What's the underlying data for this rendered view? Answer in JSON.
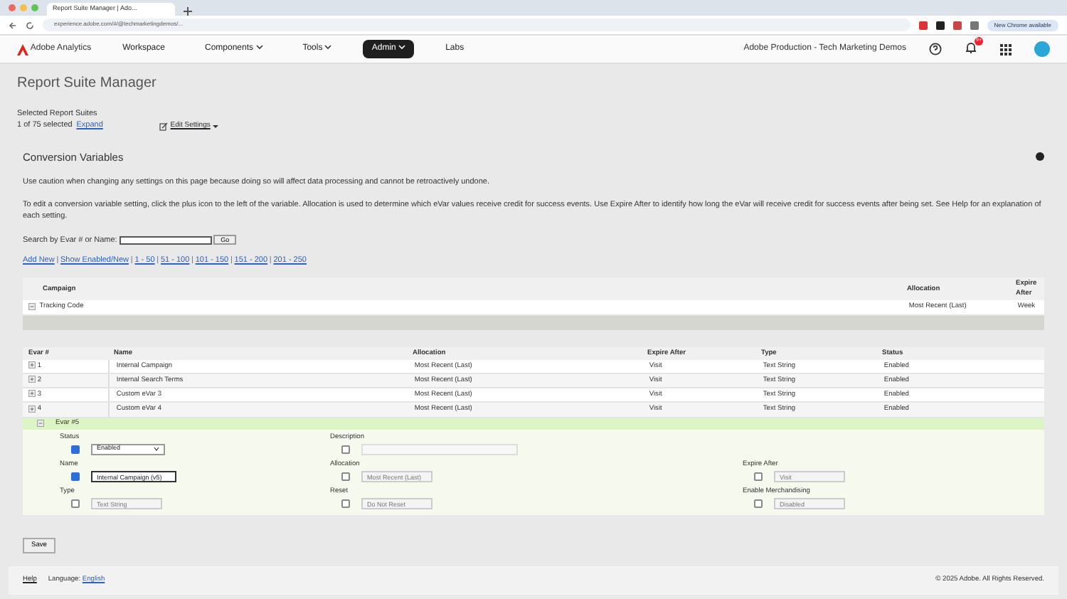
{
  "browser": {
    "tab_title": "Report Suite Manager | Ado...",
    "address": "experience.adobe.com/#/@techmarketingdemos/...",
    "update_button": "New Chrome available"
  },
  "nav": {
    "brand": "Adobe Analytics",
    "items": [
      {
        "label": "Workspace",
        "dropdown": false,
        "selected": false
      },
      {
        "label": "Components",
        "dropdown": true,
        "selected": false
      },
      {
        "label": "Tools",
        "dropdown": true,
        "selected": false
      },
      {
        "label": "Admin",
        "dropdown": true,
        "selected": true
      },
      {
        "label": "Labs",
        "dropdown": false,
        "selected": false
      }
    ],
    "org": "Adobe Production - Tech Marketing Demos",
    "notifications": "9+"
  },
  "page_title": "Report Suite Manager",
  "selection": {
    "label": "Selected Report Suites",
    "count": "1 of 75 selected",
    "expand": "Expand",
    "edit_settings": "Edit Settings"
  },
  "section": {
    "title": "Conversion Variables",
    "caution": "Use caution when changing any settings on this page because doing so will affect data processing and cannot be retroactively undone.",
    "instructions": "To edit a conversion variable setting, click the plus icon to the left of the variable. Allocation is used to determine which eVar values receive credit for success events. Use Expire After to identify how long the eVar will receive credit for success events after being set. See Help for an explanation of each setting.",
    "search_label": "Search by Evar # or Name:",
    "go_button": "Go",
    "link_separator": "|",
    "links": [
      "Add New",
      "Show Enabled/New",
      "1 - 50",
      "51 - 100",
      "101 - 150",
      "151 - 200",
      "201 - 250"
    ]
  },
  "campaign_table": {
    "columns": [
      "Campaign",
      "Allocation",
      "Expire After"
    ],
    "rows": [
      [
        "Tracking Code",
        "Most Recent (Last)",
        "Week"
      ]
    ]
  },
  "evar_table": {
    "columns": [
      "Evar #",
      "Name",
      "Allocation",
      "Expire After",
      "Type",
      "Status"
    ],
    "rows": [
      [
        "1",
        "Internal Campaign",
        "Most Recent (Last)",
        "Visit",
        "Text String",
        "Enabled"
      ],
      [
        "2",
        "Internal Search Terms",
        "Most Recent (Last)",
        "Visit",
        "Text String",
        "Enabled"
      ],
      [
        "3",
        "Custom eVar 3",
        "Most Recent (Last)",
        "Visit",
        "Text String",
        "Enabled"
      ],
      [
        "4",
        "Custom eVar 4",
        "Most Recent (Last)",
        "Visit",
        "Text String",
        "Enabled"
      ]
    ]
  },
  "expanded": {
    "title": "Evar #5",
    "fields": [
      {
        "label": "Status",
        "checked": true,
        "kind": "select",
        "value": "Enabled"
      },
      {
        "label": "Description",
        "checked": false,
        "kind": "text"
      },
      {
        "label": "Name",
        "checked": true,
        "kind": "text",
        "value": "Internal Campaign (v5)"
      },
      {
        "label": "Allocation",
        "checked": false,
        "kind": "readonly",
        "value": "Most Recent (Last)"
      },
      {
        "label": "Expire After",
        "checked": false,
        "kind": "readonly",
        "value": "Visit"
      },
      {
        "label": "Type",
        "checked": false,
        "kind": "readonly",
        "value": "Text String"
      },
      {
        "label": "Reset",
        "checked": false,
        "kind": "readonly",
        "value": "Do Not Reset"
      },
      {
        "label": "Enable Merchandising",
        "checked": false,
        "kind": "readonly",
        "value": "Disabled"
      }
    ]
  },
  "save_button": "Save",
  "footer": {
    "help": "Help",
    "language_label": "Language:",
    "language": "English",
    "copyright": "© 2025 Adobe. All Rights Reserved."
  }
}
